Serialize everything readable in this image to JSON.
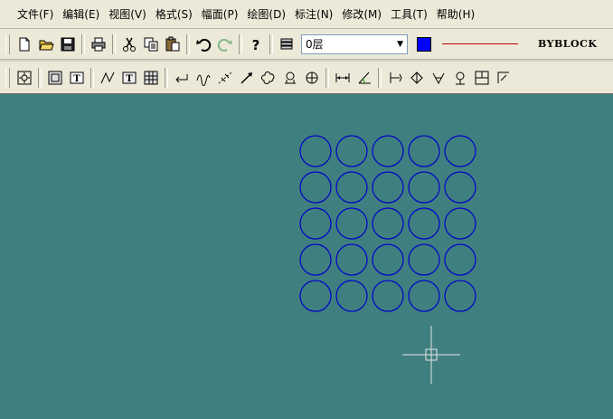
{
  "menu": [
    {
      "label": "文件(F)"
    },
    {
      "label": "编辑(E)"
    },
    {
      "label": "视图(V)"
    },
    {
      "label": "格式(S)"
    },
    {
      "label": "幅面(P)"
    },
    {
      "label": "绘图(D)"
    },
    {
      "label": "标注(N)"
    },
    {
      "label": "修改(M)"
    },
    {
      "label": "工具(T)"
    },
    {
      "label": "帮助(H)"
    }
  ],
  "properties": {
    "layer": "0层",
    "color": "#0000ff",
    "linetype_color": "#c00000",
    "linetype": "BYBLOCK"
  },
  "drawing": {
    "background": "#3f7f7f",
    "circle_color": "#0000c8",
    "circle_grid": {
      "rows": 5,
      "cols": 5
    },
    "cursor_color": "#e6e6e6"
  }
}
